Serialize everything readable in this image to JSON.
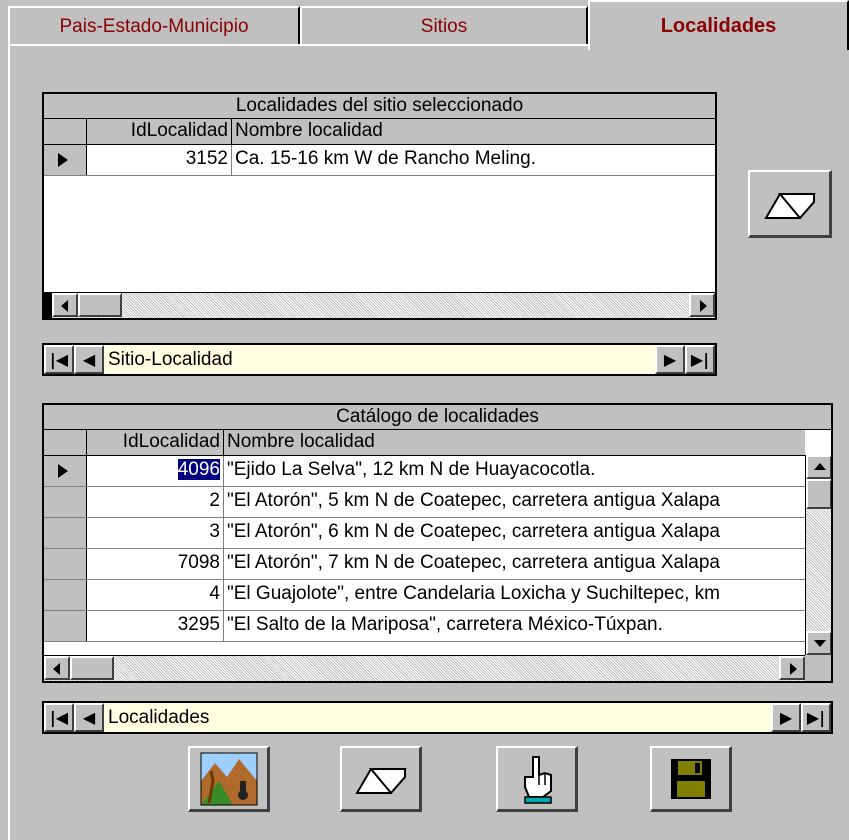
{
  "tabs": [
    {
      "label": "Pais-Estado-Municipio"
    },
    {
      "label": "Sitios"
    },
    {
      "label": "Localidades"
    }
  ],
  "grid1": {
    "title": "Localidades del sitio seleccionado",
    "col_id": "IdLocalidad",
    "col_name": "Nombre localidad",
    "rows": [
      {
        "id": "3152",
        "name": "Ca. 15-16 km W de Rancho Meling."
      }
    ]
  },
  "nav1": {
    "label": "Sitio-Localidad"
  },
  "grid2": {
    "title": "Catálogo de localidades",
    "col_id": "IdLocalidad",
    "col_name": "Nombre localidad",
    "rows": [
      {
        "id": "4096",
        "name": "\"Ejido La Selva\", 12 km N de Huayacocotla."
      },
      {
        "id": "2",
        "name": "\"El Atorón\", 5 km N de Coatepec, carretera antigua Xalapa"
      },
      {
        "id": "3",
        "name": "\"El Atorón\", 6 km N de Coatepec, carretera antigua Xalapa"
      },
      {
        "id": "7098",
        "name": "\"El Atorón\", 7 km N de Coatepec, carretera antigua Xalapa"
      },
      {
        "id": "4",
        "name": "\"El Guajolote\", entre Candelaria Loxicha y Suchiltepec, km"
      },
      {
        "id": "3295",
        "name": "\"El Salto de la Mariposa\", carretera México-Túxpan."
      }
    ]
  },
  "nav2": {
    "label": "Localidades"
  },
  "icons": {
    "eraser": "eraser-icon",
    "map": "map-picture-icon",
    "hand": "pointing-hand-icon",
    "save": "floppy-disk-icon"
  },
  "colors": {
    "tab_text": "#8b0000",
    "nav_background": "#ffffe1",
    "selection": "#000080"
  }
}
